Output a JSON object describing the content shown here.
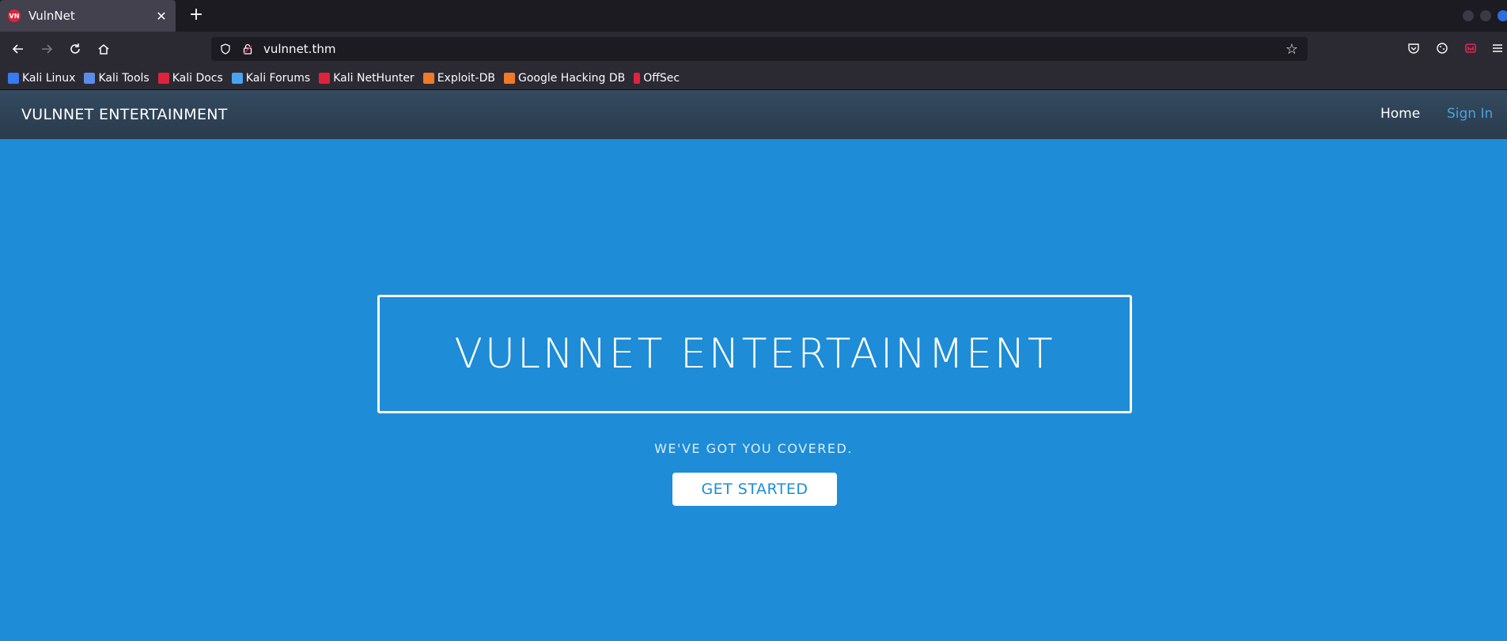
{
  "browser": {
    "tab": {
      "title": "VulnNet",
      "favicon": "vulnnet-favicon",
      "close_glyph": "✕"
    },
    "new_tab_glyph": "+",
    "url": "vulnnet.thm",
    "bookmarks": [
      {
        "label": "Kali Linux",
        "color": "#367bf0"
      },
      {
        "label": "Kali Tools",
        "color": "#5b8de8"
      },
      {
        "label": "Kali Docs",
        "color": "#e0233c"
      },
      {
        "label": "Kali Forums",
        "color": "#4aa3f0"
      },
      {
        "label": "Kali NetHunter",
        "color": "#e0233c"
      },
      {
        "label": "Exploit-DB",
        "color": "#f07a2a"
      },
      {
        "label": "Google Hacking DB",
        "color": "#f07a2a"
      },
      {
        "label": "OffSec",
        "color": "#e0233c"
      }
    ]
  },
  "site": {
    "brand": "VULNNET ENTERTAINMENT",
    "nav": {
      "home": "Home",
      "signin": "Sign In"
    },
    "hero_title": "VULNNET ENTERTAINMENT",
    "tagline": "WE'VE GOT YOU COVERED.",
    "cta": "GET STARTED",
    "colors": {
      "hero_bg": "#1e8cd6",
      "nav_bg": "#2c3e50",
      "signin": "#4aa3df"
    }
  }
}
